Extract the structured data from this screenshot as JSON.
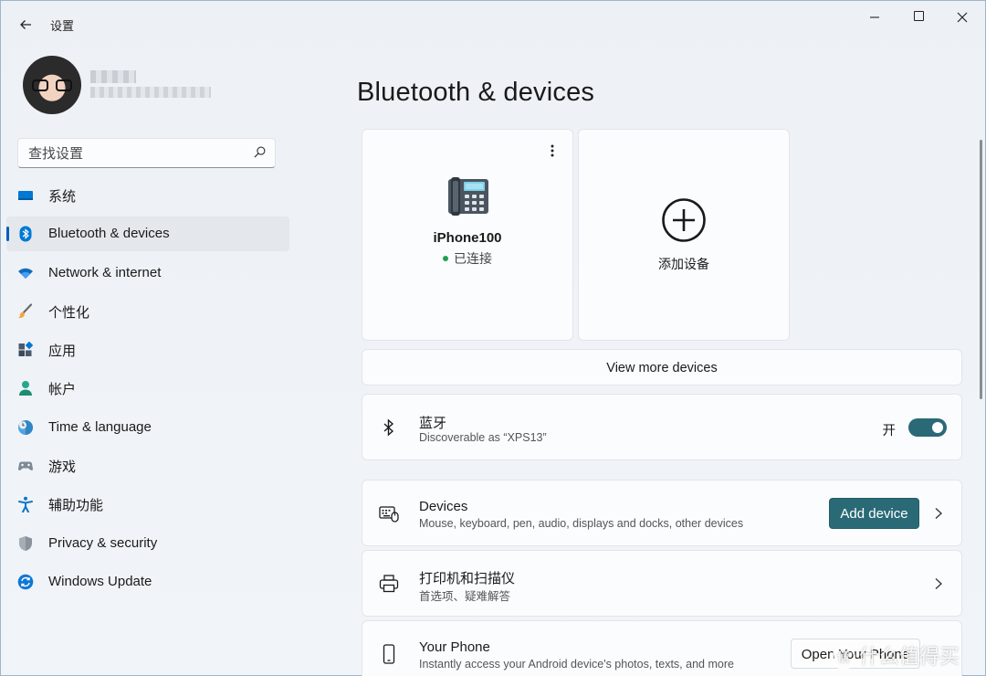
{
  "window": {
    "title": "设置",
    "controls": {
      "minimize": "—",
      "maximize": "",
      "close": "✕"
    }
  },
  "search": {
    "placeholder": "查找设置"
  },
  "sidebar": {
    "items": [
      {
        "label": "系统",
        "icon": "monitor-icon",
        "active": false
      },
      {
        "label": "Bluetooth & devices",
        "icon": "bluetooth-icon",
        "active": true
      },
      {
        "label": "Network & internet",
        "icon": "wifi-icon",
        "active": false
      },
      {
        "label": "个性化",
        "icon": "brush-icon",
        "active": false
      },
      {
        "label": "应用",
        "icon": "apps-icon",
        "active": false
      },
      {
        "label": "帐户",
        "icon": "person-icon",
        "active": false
      },
      {
        "label": "Time & language",
        "icon": "globe-clock-icon",
        "active": false
      },
      {
        "label": "游戏",
        "icon": "gamepad-icon",
        "active": false
      },
      {
        "label": "辅助功能",
        "icon": "accessibility-icon",
        "active": false
      },
      {
        "label": "Privacy & security",
        "icon": "shield-icon",
        "active": false
      },
      {
        "label": "Windows Update",
        "icon": "update-icon",
        "active": false
      }
    ]
  },
  "main": {
    "title": "Bluetooth & devices",
    "device_card": {
      "name": "iPhone100",
      "status": "已连接",
      "more": "⋮"
    },
    "add_card": {
      "label": "添加设备"
    },
    "view_more": "View more devices",
    "bluetooth": {
      "title": "蓝牙",
      "subtitle": "Discoverable as “XPS13”",
      "toggle_label": "开",
      "on": true
    },
    "devices_row": {
      "title": "Devices",
      "subtitle": "Mouse, keyboard, pen, audio, displays and docks, other devices",
      "button": "Add device"
    },
    "printers_row": {
      "title": "打印机和扫描仪",
      "subtitle": "首选项、疑难解答"
    },
    "phone_row": {
      "title": "Your Phone",
      "subtitle": "Instantly access your Android device's photos, texts, and more",
      "button": "Open Your Phone"
    }
  },
  "watermark": {
    "text": "什么值得买",
    "glyph": "值"
  },
  "colors": {
    "accent": "#2a6a77",
    "nav_indicator": "#005fb8",
    "connected": "#1aa350"
  }
}
